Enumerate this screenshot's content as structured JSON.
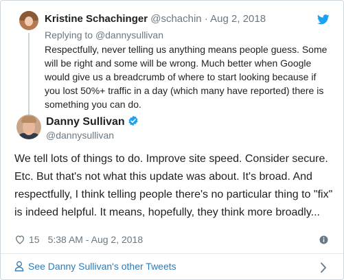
{
  "parent_tweet": {
    "name": "Kristine Schachinger",
    "handle": "@schachin",
    "separator": "·",
    "date": "Aug 2, 2018",
    "replying_prefix": "Replying to",
    "replying_handle": "@dannysullivan",
    "text": "Respectfully, never telling us anything means people guess. Some will be right and some will be wrong. Much better when Google would give us a breadcrumb of where to start looking because if you lost 50%+ traffic in a day (which many have reported) there is something you can do."
  },
  "main_tweet": {
    "name": "Danny Sullivan",
    "handle": "@dannysullivan",
    "text": "We tell lots of things to do. Improve site speed. Consider secure. Etc. But that's not what this update was about. It's broad. And respectfully, I think telling people there's no particular thing to \"fix\" is indeed helpful. It means, hopefully, they think more broadly...",
    "likes": "15",
    "timestamp": "5:38 AM - Aug 2, 2018"
  },
  "footer": {
    "link_text": "See Danny Sullivan's other Tweets"
  },
  "icons": {
    "brand": "twitter-bird-icon",
    "verified": "verified-badge-icon",
    "like": "heart-icon",
    "info": "info-icon",
    "profile": "person-icon",
    "chevron": "chevron-right-icon"
  },
  "colors": {
    "brand_blue": "#1da1f2",
    "link_blue": "#2b7bb9",
    "text": "#1c2022",
    "muted": "#697882",
    "border": "#ccd6dd"
  }
}
